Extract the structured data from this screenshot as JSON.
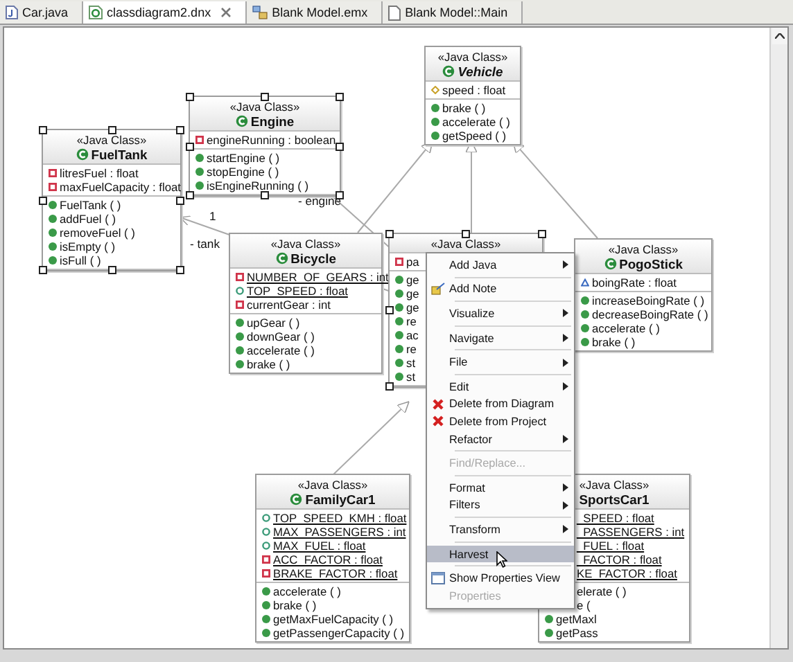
{
  "tabs": [
    {
      "label": "Car.java",
      "selected": false,
      "kind": "java"
    },
    {
      "label": "classdiagram2.dnx",
      "selected": true,
      "kind": "diagram"
    },
    {
      "label": "Blank Model.emx",
      "selected": false,
      "kind": "model"
    },
    {
      "label": "Blank Model::Main",
      "selected": false,
      "kind": "page"
    }
  ],
  "classes": [
    {
      "stereotype": "«Java Class»",
      "name": "FuelTank",
      "abstract": false,
      "selected": true,
      "attributes": [
        {
          "kind": "private",
          "text": "litresFuel : float",
          "static": false,
          "covered": false
        },
        {
          "kind": "private",
          "text": "maxFuelCapacity : float",
          "static": false,
          "covered": false
        }
      ],
      "operations": [
        {
          "kind": "method",
          "text": "FuelTank ( )",
          "covered": false
        },
        {
          "kind": "method",
          "text": "addFuel ( )",
          "covered": false
        },
        {
          "kind": "method",
          "text": "removeFuel ( )",
          "covered": false
        },
        {
          "kind": "method",
          "text": "isEmpty ( )",
          "covered": false
        },
        {
          "kind": "method",
          "text": "isFull ( )",
          "covered": false
        }
      ]
    },
    {
      "stereotype": "«Java Class»",
      "name": "Engine",
      "abstract": false,
      "selected": true,
      "attributes": [
        {
          "kind": "private",
          "text": "engineRunning : boolean",
          "static": false,
          "covered": false
        }
      ],
      "operations": [
        {
          "kind": "method",
          "text": "startEngine ( )",
          "covered": false
        },
        {
          "kind": "method",
          "text": "stopEngine ( )",
          "covered": false
        },
        {
          "kind": "method",
          "text": "isEngineRunning ( )",
          "covered": false
        }
      ]
    },
    {
      "stereotype": "«Java Class»",
      "name": "Vehicle",
      "abstract": true,
      "selected": false,
      "attributes": [
        {
          "kind": "protected",
          "text": "speed : float",
          "static": false,
          "covered": false
        }
      ],
      "operations": [
        {
          "kind": "method",
          "text": "brake ( )",
          "covered": false
        },
        {
          "kind": "method",
          "text": "accelerate ( )",
          "covered": false
        },
        {
          "kind": "method",
          "text": "getSpeed ( )",
          "covered": false
        }
      ]
    },
    {
      "stereotype": "«Java Class»",
      "name": "Bicycle",
      "abstract": false,
      "selected": false,
      "attributes": [
        {
          "kind": "private",
          "text": "NUMBER_OF_GEARS : int",
          "static": true,
          "covered": false
        },
        {
          "kind": "public",
          "text": "TOP_SPEED : float",
          "static": true,
          "covered": false
        },
        {
          "kind": "private",
          "text": "currentGear : int",
          "static": false,
          "covered": false
        }
      ],
      "operations": [
        {
          "kind": "method",
          "text": "upGear ( )",
          "covered": false
        },
        {
          "kind": "method",
          "text": "downGear ( )",
          "covered": false
        },
        {
          "kind": "method",
          "text": "accelerate ( )",
          "covered": false
        },
        {
          "kind": "method",
          "text": "brake ( )",
          "covered": false
        }
      ]
    },
    {
      "stereotype": "«Java Class»",
      "selected": true,
      "attributes": [
        {
          "kind": "private",
          "text": "pa",
          "static": false,
          "covered": false
        }
      ],
      "operations": [
        {
          "kind": "method",
          "text": "ge",
          "covered": false
        },
        {
          "kind": "method",
          "text": "ge",
          "covered": false
        },
        {
          "kind": "method",
          "text": "ge",
          "covered": false
        },
        {
          "kind": "method",
          "text": "re",
          "covered": false
        },
        {
          "kind": "method",
          "text": "ac",
          "covered": false
        },
        {
          "kind": "method",
          "text": "re",
          "covered": false
        },
        {
          "kind": "method",
          "text": "st",
          "covered": false
        },
        {
          "kind": "method",
          "text": "st",
          "covered": false
        }
      ]
    },
    {
      "stereotype": "«Java Class»",
      "name": "PogoStick",
      "abstract": false,
      "selected": false,
      "attributes": [
        {
          "kind": "package",
          "text": "boingRate : float",
          "static": false,
          "covered": false
        }
      ],
      "operations": [
        {
          "kind": "method",
          "text": "increaseBoingRate ( )",
          "covered": false
        },
        {
          "kind": "method",
          "text": "decreaseBoingRate ( )",
          "covered": false
        },
        {
          "kind": "method",
          "text": "accelerate ( )",
          "covered": false
        },
        {
          "kind": "method",
          "text": "brake ( )",
          "covered": false
        }
      ]
    },
    {
      "stereotype": "«Java Class»",
      "name": "FamilyCar1",
      "abstract": false,
      "selected": false,
      "attributes": [
        {
          "kind": "public",
          "text": "TOP_SPEED_KMH : float",
          "static": true,
          "covered": false
        },
        {
          "kind": "public",
          "text": "MAX_PASSENGERS : int",
          "static": true,
          "covered": false
        },
        {
          "kind": "public",
          "text": "MAX_FUEL : float",
          "static": true,
          "covered": false
        },
        {
          "kind": "private",
          "text": "ACC_FACTOR : float",
          "static": true,
          "covered": false
        },
        {
          "kind": "private",
          "text": "BRAKE_FACTOR : float",
          "static": true,
          "covered": false
        }
      ],
      "operations": [
        {
          "kind": "method",
          "text": "accelerate ( )",
          "covered": false
        },
        {
          "kind": "method",
          "text": "brake ( )",
          "covered": false
        },
        {
          "kind": "method",
          "text": "getMaxFuelCapacity ( )",
          "covered": false
        },
        {
          "kind": "method",
          "text": "getPassengerCapacity ( )",
          "covered": false
        }
      ]
    },
    {
      "stereotype": "«Java Class»",
      "name": "SportsCar1",
      "abstract": false,
      "selected": false,
      "attributes": [
        {
          "text": "_SPEED : float",
          "static": true,
          "covered": true
        },
        {
          "text": "_PASSENGERS : int",
          "static": true,
          "covered": true
        },
        {
          "text": "_FUEL : float",
          "static": true,
          "covered": true
        },
        {
          "text": "_FACTOR : float",
          "static": true,
          "covered": true
        },
        {
          "text": "KE_FACTOR : float",
          "static": true,
          "covered": true
        }
      ],
      "operations": [
        {
          "text": "elerate ( )",
          "covered": true
        },
        {
          "text": "e (",
          "covered": true
        },
        {
          "kind": "method",
          "text": "getMaxl",
          "covered": false
        },
        {
          "kind": "method",
          "text": "getPass",
          "covered": false
        }
      ]
    }
  ],
  "labels": [
    "- engine",
    "1",
    "- tank"
  ],
  "menu": [
    {
      "kind": "item",
      "label": "Add Java",
      "submenu": true,
      "disabled": false,
      "selected": false
    },
    {
      "kind": "separator"
    },
    {
      "kind": "note",
      "label": "Add Note",
      "submenu": false,
      "disabled": false,
      "selected": false
    },
    {
      "kind": "separator"
    },
    {
      "kind": "item",
      "label": "Visualize",
      "submenu": true,
      "disabled": false,
      "selected": false
    },
    {
      "kind": "separator"
    },
    {
      "kind": "item",
      "label": "Navigate",
      "submenu": true,
      "disabled": false,
      "selected": false
    },
    {
      "kind": "separator"
    },
    {
      "kind": "item",
      "label": "File",
      "submenu": true,
      "disabled": false,
      "selected": false
    },
    {
      "kind": "separator"
    },
    {
      "kind": "item",
      "label": "Edit",
      "submenu": true,
      "disabled": false,
      "selected": false
    },
    {
      "kind": "delete",
      "label": "Delete from Diagram",
      "submenu": false,
      "disabled": false,
      "selected": false
    },
    {
      "kind": "delete",
      "label": "Delete from Project",
      "submenu": false,
      "disabled": false,
      "selected": false
    },
    {
      "kind": "item",
      "label": "Refactor",
      "submenu": true,
      "disabled": false,
      "selected": false
    },
    {
      "kind": "separator"
    },
    {
      "kind": "item",
      "label": "Find/Replace...",
      "submenu": false,
      "disabled": true,
      "selected": false
    },
    {
      "kind": "separator"
    },
    {
      "kind": "item",
      "label": "Format",
      "submenu": true,
      "disabled": false,
      "selected": false
    },
    {
      "kind": "item",
      "label": "Filters",
      "submenu": true,
      "disabled": false,
      "selected": false
    },
    {
      "kind": "separator"
    },
    {
      "kind": "item",
      "label": "Transform",
      "submenu": true,
      "disabled": false,
      "selected": false
    },
    {
      "kind": "separator"
    },
    {
      "kind": "item",
      "label": "Harvest",
      "submenu": false,
      "disabled": false,
      "selected": true
    },
    {
      "kind": "separator"
    },
    {
      "kind": "view",
      "label": "Show Properties View",
      "submenu": false,
      "disabled": false,
      "selected": false
    },
    {
      "kind": "item",
      "label": "Properties",
      "submenu": false,
      "disabled": true,
      "selected": false
    }
  ]
}
